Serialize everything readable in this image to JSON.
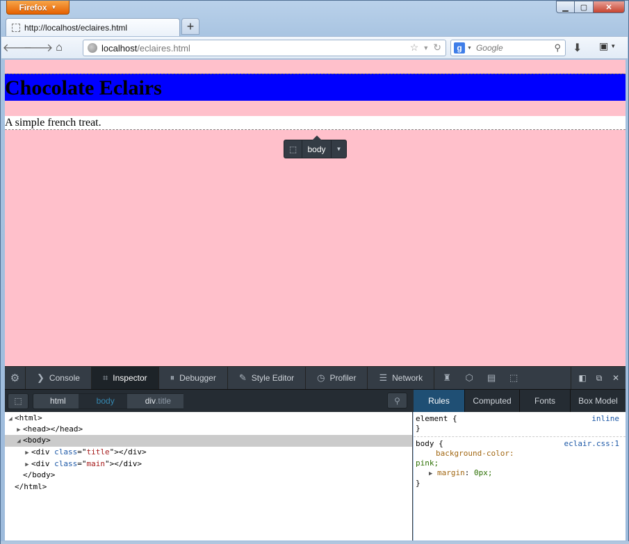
{
  "window": {
    "app_button_label": "Firefox",
    "controls": {
      "minimize": "▁",
      "maximize": "▢",
      "close": "✕"
    }
  },
  "tabs": [
    {
      "label": "http://localhost/eclaires.html"
    }
  ],
  "navbar": {
    "url_host": "localhost",
    "url_path": "/eclaires.html",
    "search_placeholder": "Google",
    "search_engine_letter": "g"
  },
  "page": {
    "title": "Chocolate Eclairs",
    "text": "A simple french treat.",
    "colors": {
      "background": "#ffc0cb",
      "title_background": "#0000ff"
    }
  },
  "infobar": {
    "tag": "body"
  },
  "devtools": {
    "tabs": [
      {
        "label": "Console",
        "icon": "console-icon"
      },
      {
        "label": "Inspector",
        "icon": "inspector-icon",
        "active": true
      },
      {
        "label": "Debugger",
        "icon": "debugger-icon"
      },
      {
        "label": "Style Editor",
        "icon": "style-editor-icon"
      },
      {
        "label": "Profiler",
        "icon": "profiler-icon"
      },
      {
        "label": "Network",
        "icon": "network-icon"
      }
    ],
    "breadcrumbs": [
      {
        "label": "html"
      },
      {
        "label": "body",
        "selected": true
      },
      {
        "label": "div",
        "class_suffix": ".title"
      }
    ],
    "sidebar_tabs": [
      {
        "label": "Rules",
        "active": true
      },
      {
        "label": "Computed"
      },
      {
        "label": "Fonts"
      },
      {
        "label": "Box Model"
      }
    ],
    "markup": [
      {
        "text": "<html>",
        "twisty": "open"
      },
      {
        "text": "<head></head>",
        "twisty": "closed"
      },
      {
        "text": "<body>",
        "twisty": "open",
        "selected": true
      },
      {
        "tag": "div",
        "attr": "class",
        "value": "title",
        "twisty": "closed"
      },
      {
        "tag": "div",
        "attr": "class",
        "value": "main",
        "twisty": "closed"
      },
      {
        "text": "</body>"
      },
      {
        "text": "</html>"
      }
    ],
    "rules": [
      {
        "selector": "element {",
        "source": "inline",
        "close": "}"
      },
      {
        "selector": "body {",
        "source": "eclair.css:1",
        "prop1": "background-color:",
        "val1": "pink;",
        "prop2": "margin",
        "val2": "0px;",
        "close": "}"
      }
    ]
  }
}
